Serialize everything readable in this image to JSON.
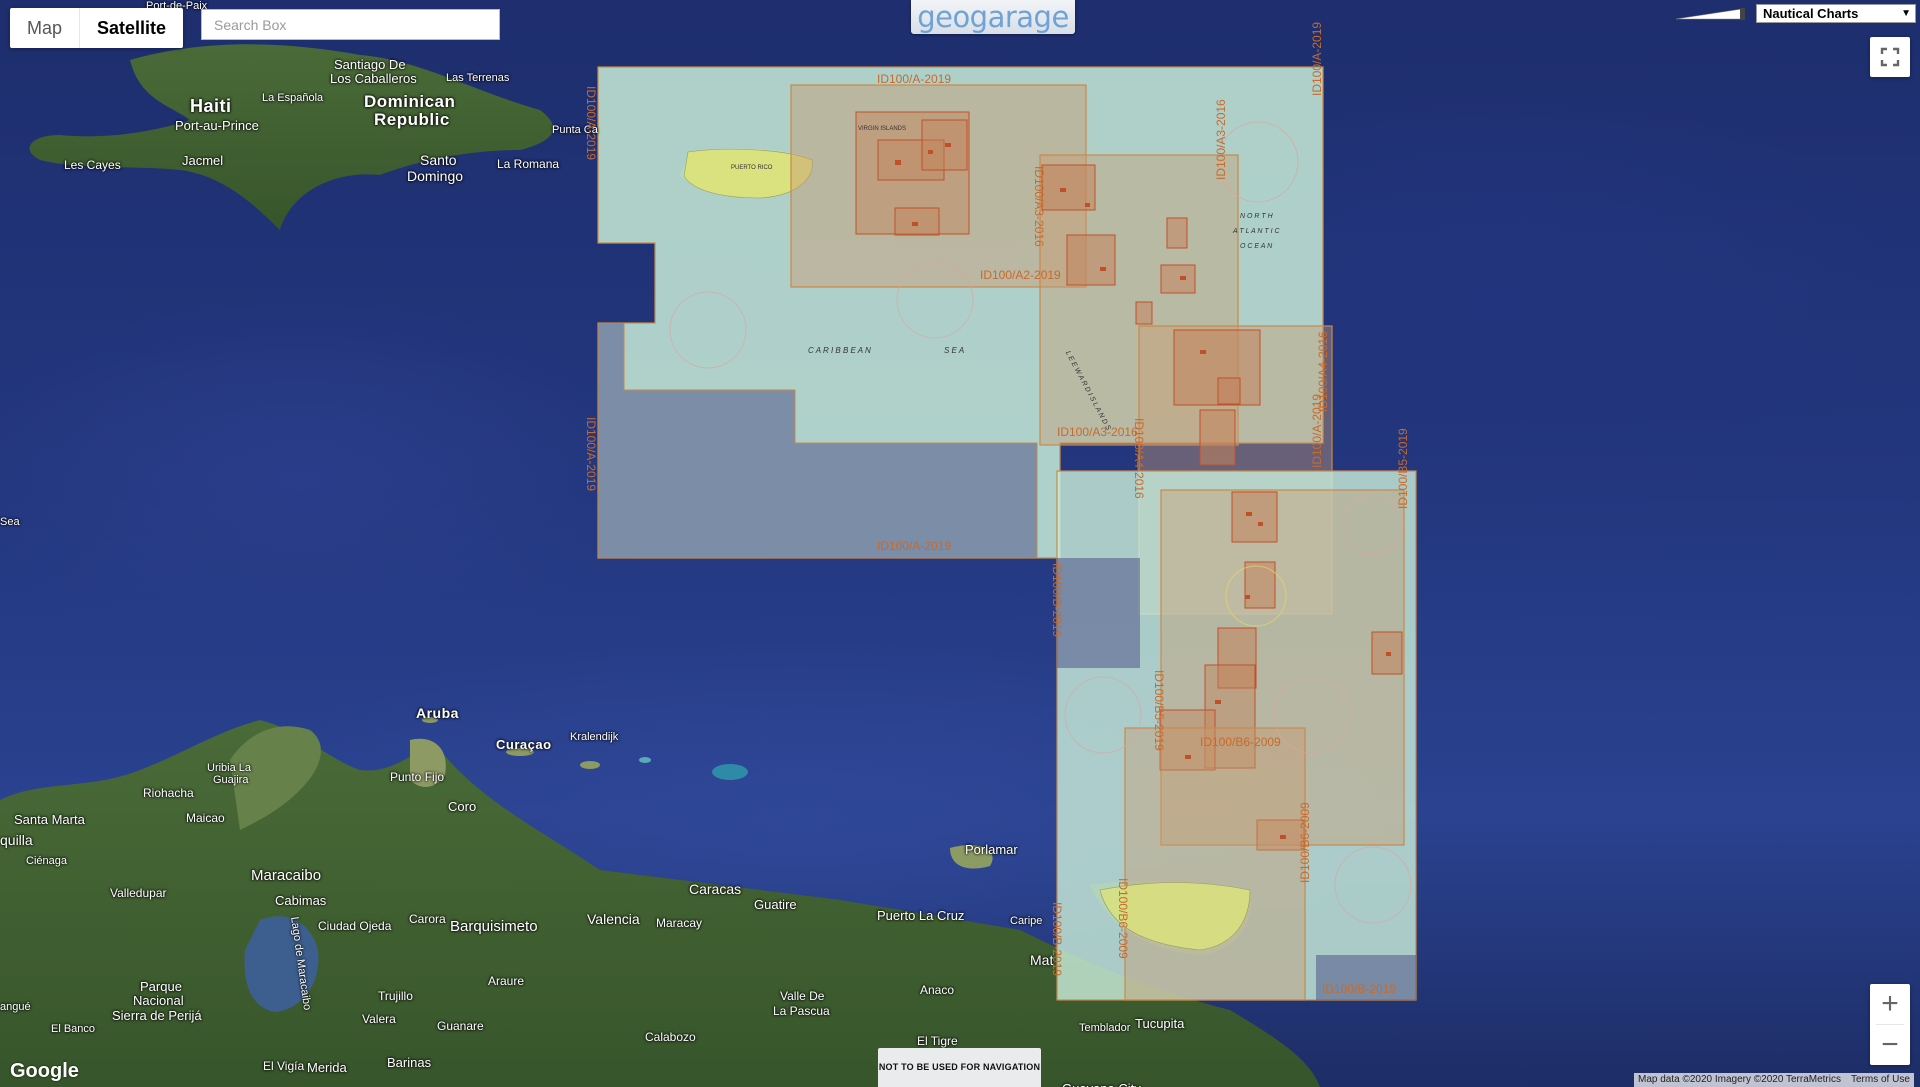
{
  "map_type": {
    "map_label": "Map",
    "satellite_label": "Satellite",
    "active": "Satellite"
  },
  "search": {
    "placeholder": "Search Box",
    "value": ""
  },
  "logo": {
    "text": "geogarage"
  },
  "layer_select": {
    "selected": "Nautical Charts"
  },
  "colors": {
    "chart_fill": "#c8ecd8",
    "chart_border": "#c9894a",
    "chart_label": "#c86a2a",
    "detail_box": "#c0502a"
  },
  "places": [
    {
      "name": "Haiti"
    },
    {
      "name": "Port-au-Prince"
    },
    {
      "name": "Dominican"
    },
    {
      "name": "Republic"
    },
    {
      "name": "Santiago De"
    },
    {
      "name": "Los Caballeros"
    },
    {
      "name": "La Española"
    },
    {
      "name": "Las Terrenas"
    },
    {
      "name": "Santo"
    },
    {
      "name": "Domingo"
    },
    {
      "name": "La Romana"
    },
    {
      "name": "Punta Ca"
    },
    {
      "name": "Les Cayes"
    },
    {
      "name": "Jacmel"
    },
    {
      "name": "Port-de-Paix"
    },
    {
      "name": "Sea"
    },
    {
      "name": "Aruba"
    },
    {
      "name": "Curaçao"
    },
    {
      "name": "Kralendijk"
    },
    {
      "name": "Uribia La"
    },
    {
      "name": "Guajira"
    },
    {
      "name": "Punto Fijo"
    },
    {
      "name": "Riohacha"
    },
    {
      "name": "Coro"
    },
    {
      "name": "Santa Marta"
    },
    {
      "name": "Maicao"
    },
    {
      "name": "quilla"
    },
    {
      "name": "Ciénaga"
    },
    {
      "name": "Valledupar"
    },
    {
      "name": "Maracaibo"
    },
    {
      "name": "Cabimas"
    },
    {
      "name": "Ciudad Ojeda"
    },
    {
      "name": "Lago de Maracaibo"
    },
    {
      "name": "Carora"
    },
    {
      "name": "Barquisimeto"
    },
    {
      "name": "Caracas"
    },
    {
      "name": "Guatire"
    },
    {
      "name": "Valencia"
    },
    {
      "name": "Maracay"
    },
    {
      "name": "Puerto La Cruz"
    },
    {
      "name": "Caripe"
    },
    {
      "name": "Porlamar"
    },
    {
      "name": "Mat"
    },
    {
      "name": "Parque"
    },
    {
      "name": "Nacional"
    },
    {
      "name": "Sierra de Perijá"
    },
    {
      "name": "angué"
    },
    {
      "name": "El Banco"
    },
    {
      "name": "Trujillo"
    },
    {
      "name": "Valera"
    },
    {
      "name": "Araure"
    },
    {
      "name": "Guanare"
    },
    {
      "name": "Barinas"
    },
    {
      "name": "El Vigía"
    },
    {
      "name": "Merida"
    },
    {
      "name": "Calabozo"
    },
    {
      "name": "Valle De"
    },
    {
      "name": "La Pascua"
    },
    {
      "name": "Anaco"
    },
    {
      "name": "El Tigre"
    },
    {
      "name": "Tucupita"
    },
    {
      "name": "Temblador"
    },
    {
      "name": "Guayana City"
    }
  ],
  "chart_labels": [
    {
      "text": "ID100/A-2019"
    },
    {
      "text": "ID100/A-2019"
    },
    {
      "text": "ID100/A-2019"
    },
    {
      "text": "ID100/A-2019"
    },
    {
      "text": "ID100/A-2019"
    },
    {
      "text": "ID100/A2-2019"
    },
    {
      "text": "ID100/A3-2016"
    },
    {
      "text": "ID100/A3-2016"
    },
    {
      "text": "ID100/A3-2016"
    },
    {
      "text": "ID100/A4-2016"
    },
    {
      "text": "ID100/A4-2016"
    },
    {
      "text": "ID100/A-2019"
    },
    {
      "text": "ID100/B5-2019"
    },
    {
      "text": "ID100/B-2019"
    },
    {
      "text": "ID100/B6-2009"
    },
    {
      "text": "ID100/B6-2009"
    },
    {
      "text": "ID100/B6-2009"
    },
    {
      "text": "ID100/B-2019"
    },
    {
      "text": "ID100/B-2019"
    },
    {
      "text": "ID100/B5-2019"
    }
  ],
  "chart_texts": {
    "caribbean": "C A R I B B E A N",
    "sea": "S E A",
    "north": "N O R T H",
    "atlantic": "A T L A N T I C",
    "ocean": "O C E A N",
    "leeward": "L E E W A R D   I S L A N D S",
    "virgin": "VIRGIN ISLANDS",
    "puerto_rico": "PUERTO RICO"
  },
  "warning": "NOT TO BE USED FOR NAVIGATION",
  "google": "Google",
  "attribution": {
    "data": "Map data ©2020 Imagery ©2020 TerraMetrics",
    "terms": "Terms of Use"
  }
}
